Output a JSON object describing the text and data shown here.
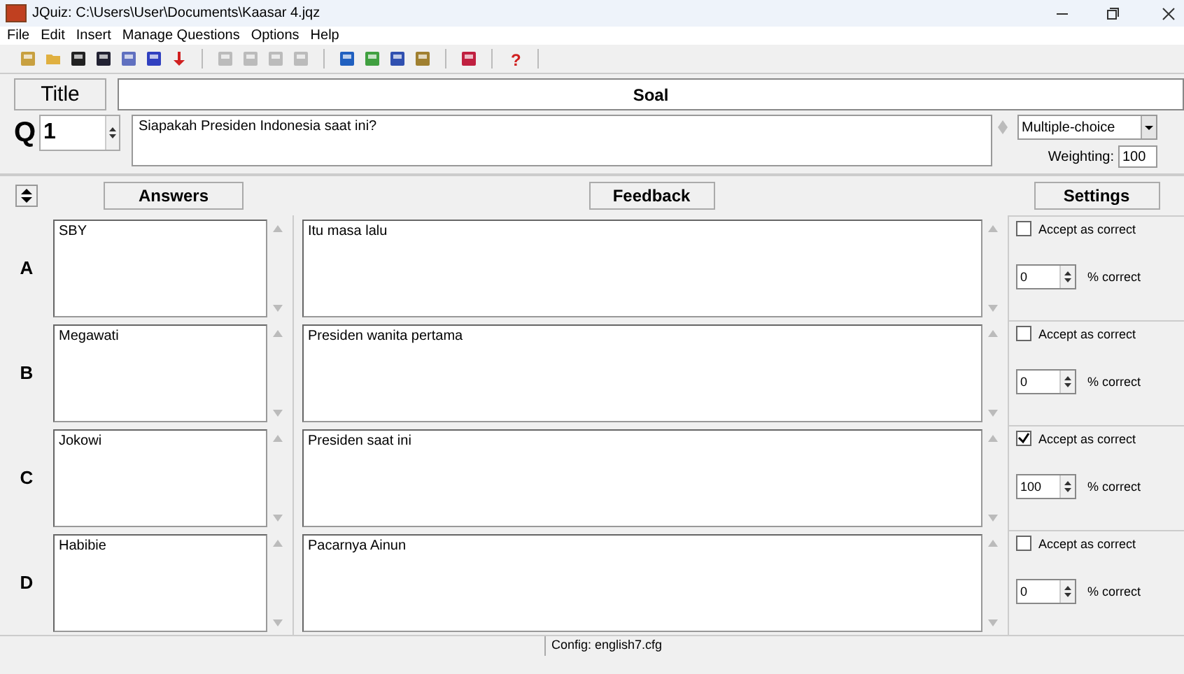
{
  "window": {
    "title": "JQuiz: C:\\Users\\User\\Documents\\Kaasar 4.jqz"
  },
  "menu": [
    "File",
    "Edit",
    "Insert",
    "Manage Questions",
    "Options",
    "Help"
  ],
  "title_button": "Title",
  "title_value": "Soal",
  "question": {
    "label": "Q",
    "number": "1",
    "text": "Siapakah Presiden Indonesia saat ini?",
    "type": "Multiple-choice",
    "weighting_label": "Weighting:",
    "weighting": "100"
  },
  "headers": {
    "answers": "Answers",
    "feedback": "Feedback",
    "settings": "Settings"
  },
  "rows": [
    {
      "letter": "A",
      "answer": "SBY",
      "feedback": "Itu masa lalu",
      "checked": false,
      "accept_label": "Accept as correct",
      "percent": "0",
      "percent_label": "% correct"
    },
    {
      "letter": "B",
      "answer": "Megawati",
      "feedback": "Presiden wanita pertama",
      "checked": false,
      "accept_label": "Accept as correct",
      "percent": "0",
      "percent_label": "% correct"
    },
    {
      "letter": "C",
      "answer": "Jokowi",
      "feedback": "Presiden saat ini",
      "checked": true,
      "accept_label": "Accept as correct",
      "percent": "100",
      "percent_label": "% correct"
    },
    {
      "letter": "D",
      "answer": "Habibie",
      "feedback": "Pacarnya Ainun",
      "checked": false,
      "accept_label": "Accept as correct",
      "percent": "0",
      "percent_label": "% correct"
    }
  ],
  "status_bar": "Config: english7.cfg",
  "help_glyph": "?"
}
